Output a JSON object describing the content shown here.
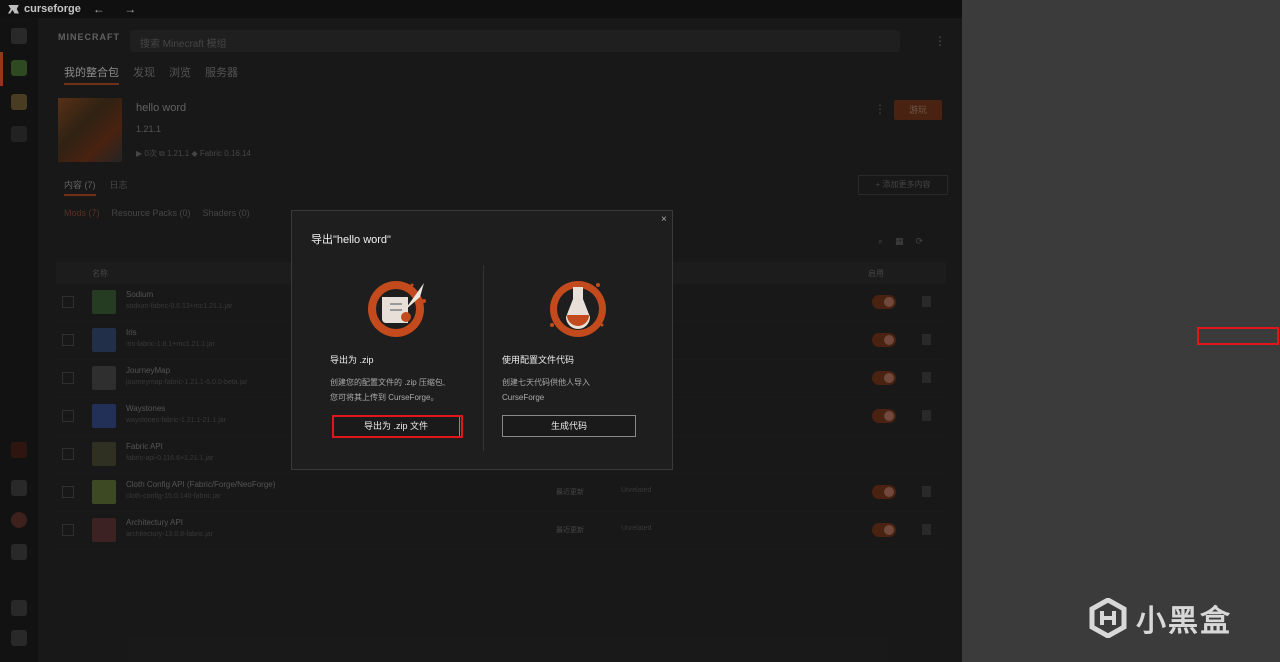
{
  "titlebar": {
    "app_name": "curseforge",
    "nav_arrows": "← →"
  },
  "header": {
    "game_logo": "MINECRAFT",
    "search_placeholder": "搜索 Minecraft 模组",
    "tabs": [
      "我的整合包",
      "发现",
      "浏览",
      "服务器"
    ]
  },
  "profile": {
    "name": "hello word",
    "version": "1.21.1",
    "meta": "▶ 0次   ⧉ 1.21.1   ◆ Fabric 0.16.14",
    "play_label": "游玩"
  },
  "subtabs": [
    "内容 (7)",
    "日志"
  ],
  "add_content_label": "+ 添加更多内容",
  "filters": [
    "Mods (7)",
    "Resource Packs (0)",
    "Shaders (0)"
  ],
  "table": {
    "header_name": "名称",
    "header_enabled": "启用",
    "rows": [
      {
        "name": "Sodium",
        "file": "sodium-fabric-0.6.13+mc1.21.1.jar",
        "status": "",
        "source": "",
        "enabled": true
      },
      {
        "name": "Iris",
        "file": "iris-fabric-1.8.1+mc1.21.1.jar",
        "status": "",
        "source": "",
        "enabled": true
      },
      {
        "name": "JourneyMap",
        "file": "journeymap-fabric-1.21.1-6.0.0-beta.jar",
        "status": "",
        "source": "",
        "enabled": true
      },
      {
        "name": "Waystones",
        "file": "waystones-fabric-1.21.1-21.1.jar",
        "status": "",
        "source": "",
        "enabled": true
      },
      {
        "name": "Fabric API",
        "file": "fabric-api-0.116.6+1.21.1.jar",
        "status": "",
        "source": "",
        "enabled": true
      },
      {
        "name": "Cloth Config API (Fabric/Forge/NeoForge)",
        "file": "cloth-config-15.0.140-fabric.jar",
        "status": "最近更新",
        "source": "Unrelated",
        "enabled": true
      },
      {
        "name": "Architectury API",
        "file": "architectury-13.0.8-fabric.jar",
        "status": "最近更新",
        "source": "Unrelated",
        "enabled": true
      }
    ]
  },
  "modal": {
    "title": "导出\"hello word\"",
    "close_icon": "×",
    "option_zip": {
      "title": "导出为 .zip",
      "desc": "创建您的配置文件的 .zip 压缩包,\n您可将其上传到 CurseForge。",
      "button": "导出为 .zip 文件"
    },
    "option_code": {
      "title": "使用配置文件代码",
      "desc": "创建七天代码供他人导入\nCurseForge",
      "button": "生成代码"
    }
  },
  "watermark": {
    "text": "小黑盒"
  },
  "colors": {
    "accent": "#e0571f",
    "highlight": "#e0161b"
  }
}
